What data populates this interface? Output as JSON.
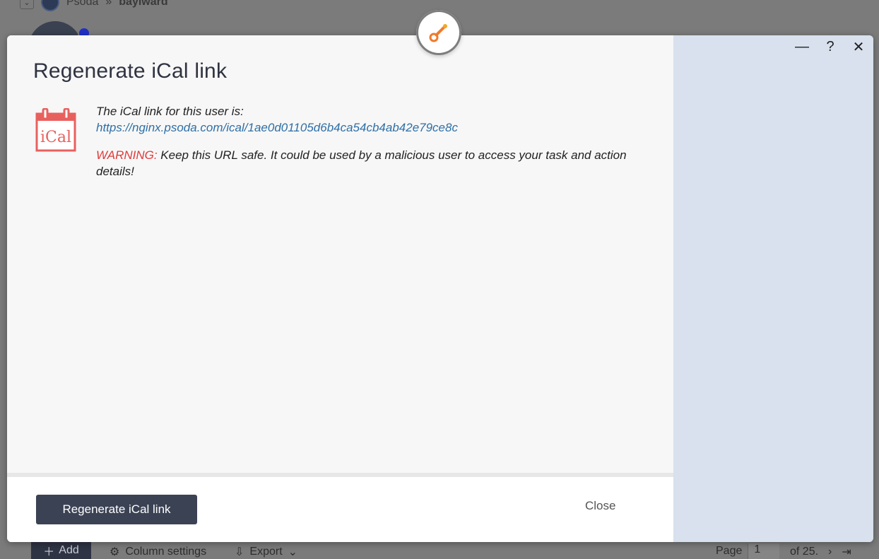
{
  "background": {
    "breadcrumb": [
      "Psoda",
      "»",
      "baylward"
    ],
    "toolbar": {
      "add_label": "Add",
      "column_settings_label": "Column settings",
      "export_label": "Export",
      "page_label": "Page",
      "page_value": "1",
      "page_total": "of 25."
    }
  },
  "modal": {
    "title": "Regenerate iCal link",
    "icon_text": "iCal",
    "intro": "The iCal link for this user is:",
    "link": "https://nginx.psoda.com/ical/1ae0d01105d6b4ca54cb4ab42e79ce8c",
    "warning_label": "WARNING:",
    "warning_text": " Keep this URL safe. It could be used by a malicious user to access your task and action details!",
    "regenerate_button": "Regenerate iCal link",
    "close_button": "Close",
    "window_controls": {
      "minimize": "—",
      "help": "?",
      "close": "✕"
    }
  },
  "colors": {
    "primary_button": "#3b4254",
    "warning": "#e03a3a",
    "link": "#2e6fa6",
    "side_panel": "#d8e1ed",
    "ical_red": "#e8605e",
    "badge_orange": "#f07a2a"
  }
}
